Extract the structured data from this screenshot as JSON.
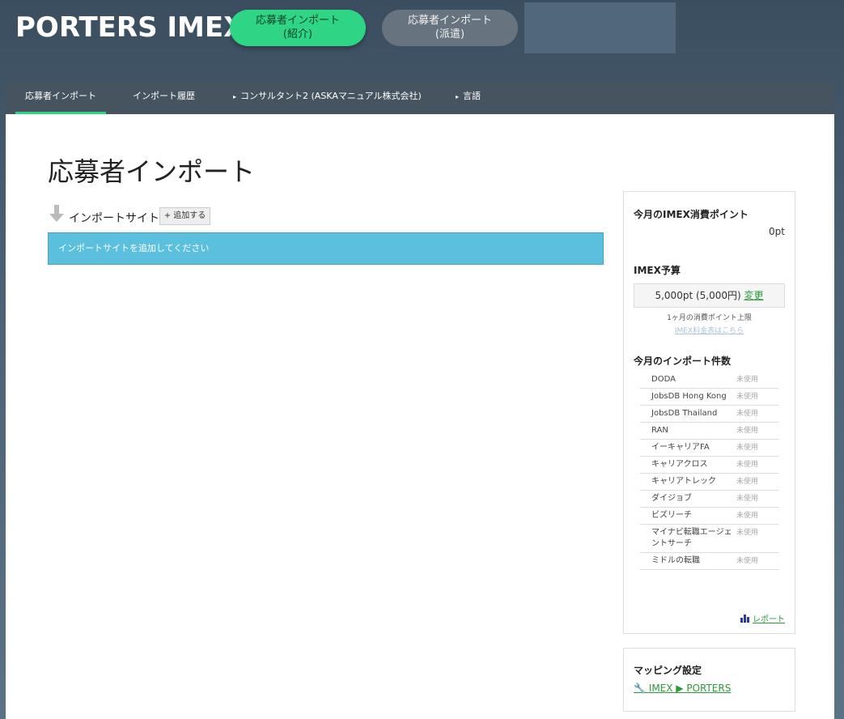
{
  "header": {
    "brand": "PORTERS IMEX",
    "mode_active": {
      "line1": "応募者インポート",
      "line2": "(紹介)"
    },
    "mode_inactive": {
      "line1": "応募者インポート",
      "line2": "(派遣)"
    }
  },
  "nav": {
    "items": [
      {
        "label": "応募者インポート",
        "active": true
      },
      {
        "label": "インポート履歴"
      },
      {
        "label": "コンサルタント2 (ASKAマニュアル株式会社)"
      },
      {
        "label": "言語"
      }
    ]
  },
  "main": {
    "title": "応募者インポート",
    "site_label": "インポートサイト",
    "add_button": "+ 追加する",
    "info": "インポートサイトを追加してください"
  },
  "sidebar": {
    "points_heading": "今月のIMEX消費ポイント",
    "points_value": "0pt",
    "budget_heading": "IMEX予算",
    "budget_value": "5,000pt (5,000円)",
    "budget_change": "変更",
    "budget_note": "1ヶ月の消費ポイント上限",
    "pricing_link": "IMEX料金表はこちら",
    "count_heading": "今月のインポート件数",
    "sites": [
      {
        "name": "DODA",
        "status": "未使用"
      },
      {
        "name": "JobsDB Hong Kong",
        "status": "未使用"
      },
      {
        "name": "JobsDB Thailand",
        "status": "未使用"
      },
      {
        "name": "RAN",
        "status": "未使用"
      },
      {
        "name": "イーキャリアFA",
        "status": "未使用"
      },
      {
        "name": "キャリアクロス",
        "status": "未使用"
      },
      {
        "name": "キャリアトレック",
        "status": "未使用"
      },
      {
        "name": "ダイジョブ",
        "status": "未使用"
      },
      {
        "name": "ビズリーチ",
        "status": "未使用"
      },
      {
        "name": "マイナビ転職エージェントサーチ",
        "status": "未使用"
      },
      {
        "name": "ミドルの転職",
        "status": "未使用"
      }
    ],
    "report_link": "レポート",
    "mapping_heading": "マッピング設定",
    "mapping_link": "IMEX ▶ PORTERS"
  },
  "colors": {
    "accent": "#2ed584",
    "info": "#5bc0de",
    "link": "#2d9a3a",
    "nav": "#46545f"
  }
}
